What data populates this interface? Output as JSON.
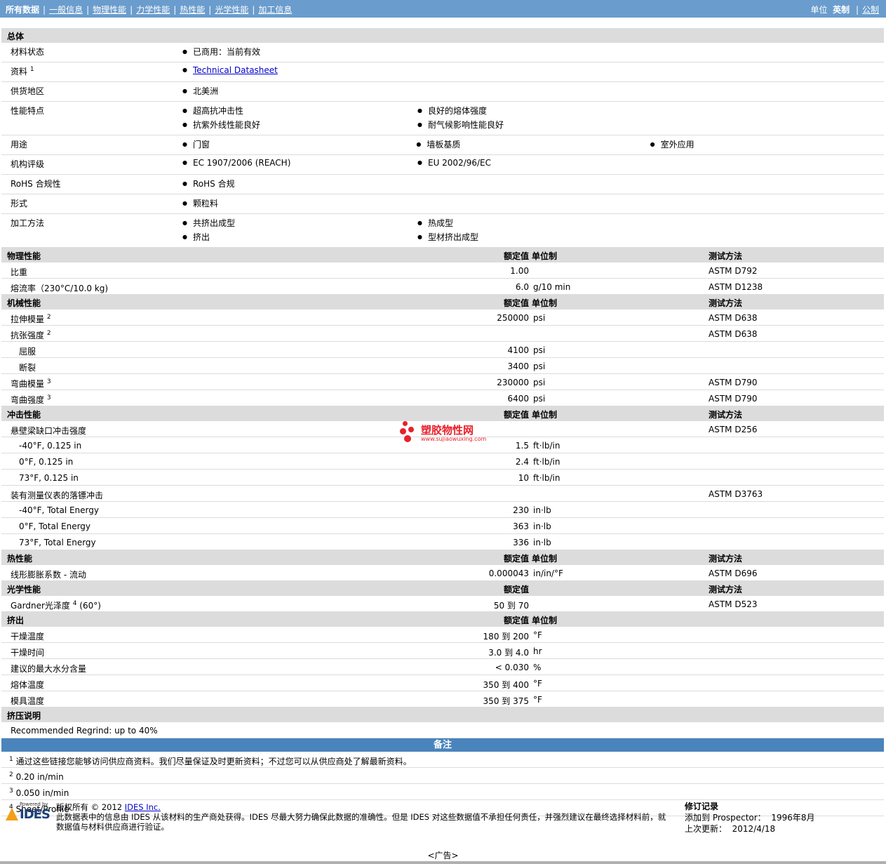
{
  "nav": {
    "items": [
      "所有数据",
      "一般信息",
      "物理性能",
      "力学性能",
      "热性能",
      "光学性能",
      "加工信息"
    ],
    "units_label": "单位",
    "unit_current": "英制",
    "unit_other": "公制"
  },
  "general": {
    "title": "总体",
    "rows": [
      {
        "label": "材料状态",
        "lines": [
          [
            "已商用：当前有效"
          ]
        ]
      },
      {
        "label": "资料",
        "sup": "1",
        "link": "Technical Datasheet"
      },
      {
        "label": "供货地区",
        "lines": [
          [
            "北美洲"
          ]
        ]
      },
      {
        "label": "性能特点",
        "lines": [
          [
            "超高抗冲击性",
            "良好的熔体强度"
          ],
          [
            "抗紫外线性能良好",
            "耐气候影响性能良好"
          ]
        ]
      },
      {
        "label": "用途",
        "lines": [
          [
            "门窗",
            "墙板基质",
            "室外应用"
          ]
        ]
      },
      {
        "label": "机构评级",
        "lines": [
          [
            "EC 1907/2006 (REACH)",
            "EU 2002/96/EC"
          ]
        ]
      },
      {
        "label": "RoHS 合规性",
        "lines": [
          [
            "RoHS 合规"
          ]
        ]
      },
      {
        "label": "形式",
        "lines": [
          [
            "颗粒料"
          ]
        ]
      },
      {
        "label": "加工方法",
        "lines": [
          [
            "共挤出成型",
            "热成型"
          ],
          [
            "挤出",
            "型材挤出成型"
          ]
        ]
      }
    ]
  },
  "headers": {
    "value": "额定值",
    "unit": "单位制",
    "method": "测试方法"
  },
  "sections": [
    {
      "title": "物理性能",
      "show_unit": true,
      "show_method": true,
      "rows": [
        {
          "label": "比重",
          "value": "1.00",
          "unit": "",
          "method": "ASTM D792"
        },
        {
          "label": "熔流率（230°C/10.0 kg)",
          "value": "6.0",
          "unit": "g/10 min",
          "method": "ASTM D1238"
        }
      ]
    },
    {
      "title": "机械性能",
      "show_unit": true,
      "show_method": true,
      "rows": [
        {
          "label": "拉伸模量",
          "sup": "2",
          "value": "250000",
          "unit": "psi",
          "method": "ASTM D638"
        },
        {
          "label": "抗张强度",
          "sup": "2",
          "value": "",
          "unit": "",
          "method": "ASTM D638"
        },
        {
          "label": "屈服",
          "sub": true,
          "value": "4100",
          "unit": "psi",
          "method": ""
        },
        {
          "label": "断裂",
          "sub": true,
          "value": "3400",
          "unit": "psi",
          "method": ""
        },
        {
          "label": "弯曲模量",
          "sup": "3",
          "value": "230000",
          "unit": "psi",
          "method": "ASTM D790"
        },
        {
          "label": "弯曲强度",
          "sup": "3",
          "value": "6400",
          "unit": "psi",
          "method": "ASTM D790"
        }
      ]
    },
    {
      "title": "冲击性能",
      "show_unit": true,
      "show_method": true,
      "rows": [
        {
          "label": "悬壁梁缺口冲击强度",
          "value": "",
          "unit": "",
          "method": "ASTM D256"
        },
        {
          "label": "-40°F, 0.125 in",
          "sub": true,
          "value": "1.5",
          "unit": "ft·lb/in",
          "method": ""
        },
        {
          "label": "0°F, 0.125 in",
          "sub": true,
          "value": "2.4",
          "unit": "ft·lb/in",
          "method": ""
        },
        {
          "label": "73°F, 0.125 in",
          "sub": true,
          "value": "10",
          "unit": "ft·lb/in",
          "method": ""
        },
        {
          "label": "装有测量仪表的落镖冲击",
          "value": "",
          "unit": "",
          "method": "ASTM D3763"
        },
        {
          "label": "-40°F, Total Energy",
          "sub": true,
          "value": "230",
          "unit": "in·lb",
          "method": ""
        },
        {
          "label": "0°F, Total Energy",
          "sub": true,
          "value": "363",
          "unit": "in·lb",
          "method": ""
        },
        {
          "label": "73°F, Total Energy",
          "sub": true,
          "value": "336",
          "unit": "in·lb",
          "method": ""
        }
      ]
    },
    {
      "title": "热性能",
      "show_unit": true,
      "show_method": true,
      "rows": [
        {
          "label": "线形膨胀系数 - 流动",
          "value": "0.000043",
          "unit": "in/in/°F",
          "method": "ASTM D696"
        }
      ]
    },
    {
      "title": "光学性能",
      "show_unit": false,
      "show_method": true,
      "rows": [
        {
          "label": "Gardner光泽度",
          "sup": "4",
          "label_suffix": " (60°)",
          "value": "50 到  70",
          "unit": "",
          "method": "ASTM D523"
        }
      ]
    },
    {
      "title": "挤出",
      "show_unit": true,
      "show_method": false,
      "rows": [
        {
          "label": "干燥温度",
          "value": "180 到  200",
          "unit": "°F",
          "method": ""
        },
        {
          "label": "干燥时间",
          "value": "3.0 到  4.0",
          "unit": "hr",
          "method": ""
        },
        {
          "label": "建议的最大水分含量",
          "value": "< 0.030",
          "unit": "%",
          "method": ""
        },
        {
          "label": "熔体温度",
          "value": "350 到  400",
          "unit": "°F",
          "method": ""
        },
        {
          "label": "模具温度",
          "value": "350 到  375",
          "unit": "°F",
          "method": ""
        }
      ]
    }
  ],
  "extrusion_notes": {
    "title": "挤压说明",
    "text": "Recommended Regrind: up to 40%"
  },
  "notes": {
    "title": "备注",
    "items": [
      {
        "num": "1",
        "text": "通过这些链接您能够访问供应商资料。我们尽量保证及时更新资料；不过您可以从供应商处了解最新资料。"
      },
      {
        "num": "2",
        "text": "0.20 in/min"
      },
      {
        "num": "3",
        "text": "0.050 in/min"
      },
      {
        "num": "4",
        "text": "Sheet/Profile"
      }
    ]
  },
  "footer": {
    "powered_by": "Powered by",
    "logo": "IDES",
    "copyright_prefix": "版权所有 © 2012 ",
    "company_link": "IDES Inc.",
    "disclaimer": "此数据表中的信息由 IDES 从该材料的生产商处获得。IDES 尽最大努力确保此数据的准确性。但是 IDES 对这些数据值不承担任何责任，并强烈建议在最终选择材料前，就数据值与材料供应商进行验证。",
    "revision_title": "修订记录",
    "added_label": "添加到 Prospector：",
    "added_value": "1996年8月",
    "updated_label": "上次更新：",
    "updated_value": "2012/4/18"
  },
  "ad": "<广告>",
  "watermark": {
    "cn": "塑胶物性网",
    "url": "www.sujiaowuxing.com",
    "color": "#e8202a"
  }
}
